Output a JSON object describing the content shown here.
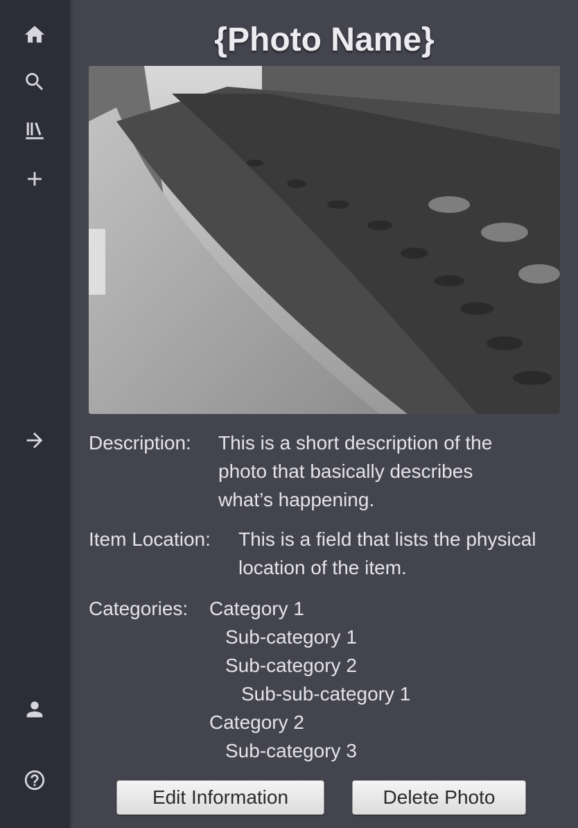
{
  "sidebar": {
    "top_items": [
      {
        "icon": "home-icon"
      },
      {
        "icon": "search-icon"
      },
      {
        "icon": "library-icon"
      },
      {
        "icon": "add-icon"
      }
    ],
    "collapse_icon": "arrow-right-icon",
    "bottom_items": [
      {
        "icon": "account-icon"
      },
      {
        "icon": "help-icon"
      }
    ]
  },
  "photo": {
    "title": "{Photo Name}"
  },
  "details": {
    "description_label": "Description:",
    "description_lines": [
      "This is a short description of the",
      "photo that basically describes",
      "what’s happening."
    ],
    "location_label": "Item Location:",
    "location_lines": [
      "This is a field that lists the physical",
      "location of the item."
    ],
    "categories_label": "Categories:",
    "categories": [
      {
        "text": "Category 1",
        "level": 0
      },
      {
        "text": "Sub-category 1",
        "level": 1
      },
      {
        "text": "Sub-category 2",
        "level": 1
      },
      {
        "text": "Sub-sub-category 1",
        "level": 2
      },
      {
        "text": "Category 2",
        "level": 0
      },
      {
        "text": "Sub-category 3",
        "level": 1
      }
    ]
  },
  "actions": {
    "edit_label": "Edit Information",
    "delete_label": "Delete Photo"
  },
  "colors": {
    "background": "#44444f",
    "sidebar": "#2d2d38",
    "text": "#e4e4e8",
    "button": "#e8e8e8"
  }
}
